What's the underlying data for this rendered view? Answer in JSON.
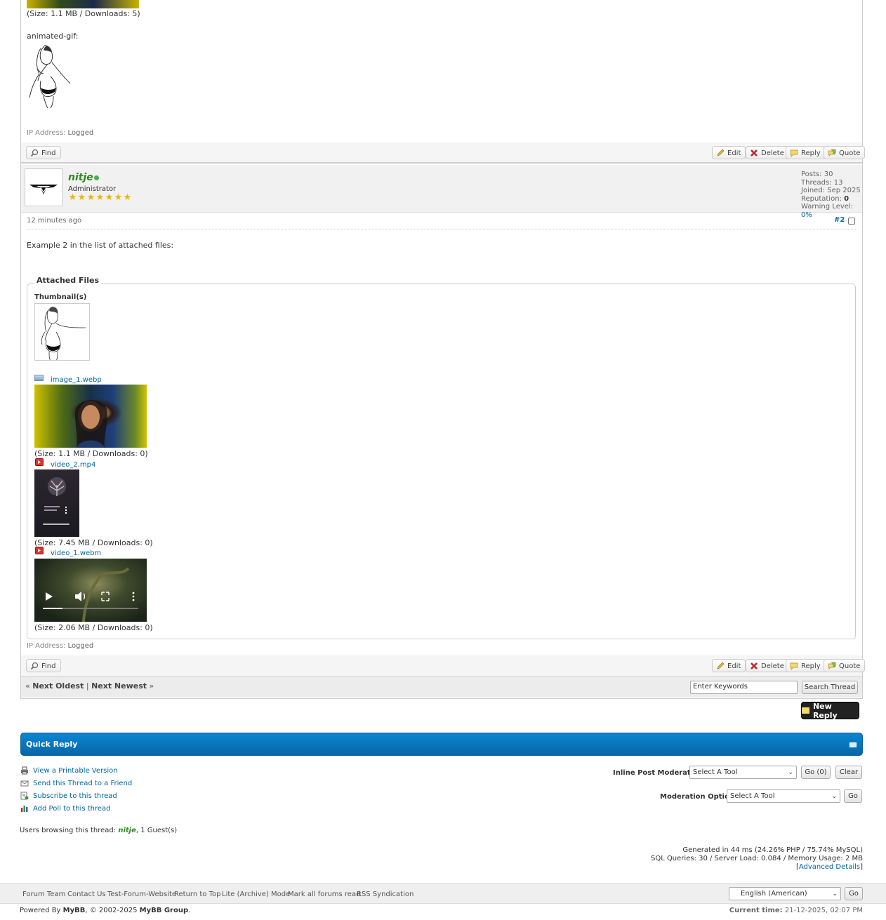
{
  "post1": {
    "size_text": "(Size: 1.1 MB / Downloads: 5)",
    "animated_label": "animated-gif:",
    "ip_label": "IP Address:",
    "ip_value": "Logged",
    "buttons": {
      "find": "Find",
      "edit": "Edit",
      "delete": "Delete",
      "reply": "Reply",
      "quote": "Quote"
    }
  },
  "post2": {
    "username": "nitje",
    "usertitle": "Administrator",
    "stars": 7,
    "stats": {
      "posts_label": "Posts:",
      "posts": "30",
      "threads_label": "Threads:",
      "threads": "13",
      "joined_label": "Joined:",
      "joined": "Sep 2025",
      "reputation_label": "Reputation:",
      "reputation": "0",
      "warning_label": "Warning Level:",
      "warning": "0%"
    },
    "time": "12 minutes ago",
    "post_number": "#2",
    "message": "Example 2 in the list of attached files:",
    "attached_legend": "Attached Files",
    "thumbnails_label": "Thumbnail(s)",
    "files": [
      {
        "name": "image_1.webp",
        "size": "(Size: 1.1 MB / Downloads: 0)",
        "icon": "image-file-icon"
      },
      {
        "name": "video_2.mp4",
        "size": "(Size: 7.45 MB / Downloads: 0)",
        "icon": "video-file-icon"
      },
      {
        "name": "video_1.webm",
        "size": "(Size: 2.06 MB / Downloads: 0)",
        "icon": "video-file-icon"
      }
    ],
    "ip_label": "IP Address:",
    "ip_value": "Logged",
    "buttons": {
      "find": "Find",
      "edit": "Edit",
      "delete": "Delete",
      "reply": "Reply",
      "quote": "Quote"
    }
  },
  "thread_nav": {
    "prev_arrow": "«",
    "next_oldest": "Next Oldest",
    "separator": "|",
    "next_newest": "Next Newest",
    "next_arrow": "»",
    "search_placeholder": "Enter Keywords",
    "search_button": "Search Thread"
  },
  "new_reply": "New Reply",
  "quick_reply": "Quick Reply",
  "tools": [
    {
      "label": "View a Printable Version",
      "icon": "printer-icon"
    },
    {
      "label": "Send this Thread to a Friend",
      "icon": "envelope-icon"
    },
    {
      "label": "Subscribe to this thread",
      "icon": "subscribe-icon"
    },
    {
      "label": "Add Poll to this thread",
      "icon": "poll-icon"
    }
  ],
  "moderation": {
    "inline_label": "Inline Post Moderation:",
    "inline_select": "Select A Tool",
    "inline_go": "Go (0)",
    "inline_clear": "Clear",
    "options_label": "Moderation Options:",
    "options_select": "Select A Tool",
    "options_go": "Go"
  },
  "browsing": {
    "prefix": "Users browsing this thread:",
    "user": "nitje",
    "suffix": ", 1 Guest(s)"
  },
  "debug": {
    "line1": "Generated in 44 ms (24.26% PHP / 75.74% MySQL)",
    "line2": "SQL Queries: 30 / Server Load: 0.084 / Memory Usage: 2 MB",
    "open_bracket": "[",
    "advanced": "Advanced Details",
    "close_bracket": "]"
  },
  "footer": {
    "links": [
      "Forum Team",
      "Contact Us",
      "Test-Forum-Website",
      "Return to Top",
      "Lite (Archive) Mode",
      "Mark all forums read",
      "RSS Syndication"
    ],
    "language": "English (American)",
    "language_go": "Go",
    "powered_prefix": "Powered By",
    "mybb": "MyBB",
    "copyright": ", © 2002-2025",
    "mybb_group": "MyBB Group",
    "period": ".",
    "current_time_label": "Current time:",
    "current_time": "21-12-2025, 02:07 PM"
  },
  "colors": {
    "link": "#0066a2",
    "username": "#2e8b22",
    "quick_reply_bar": "#0a78c2",
    "new_reply_button": "#222222"
  }
}
